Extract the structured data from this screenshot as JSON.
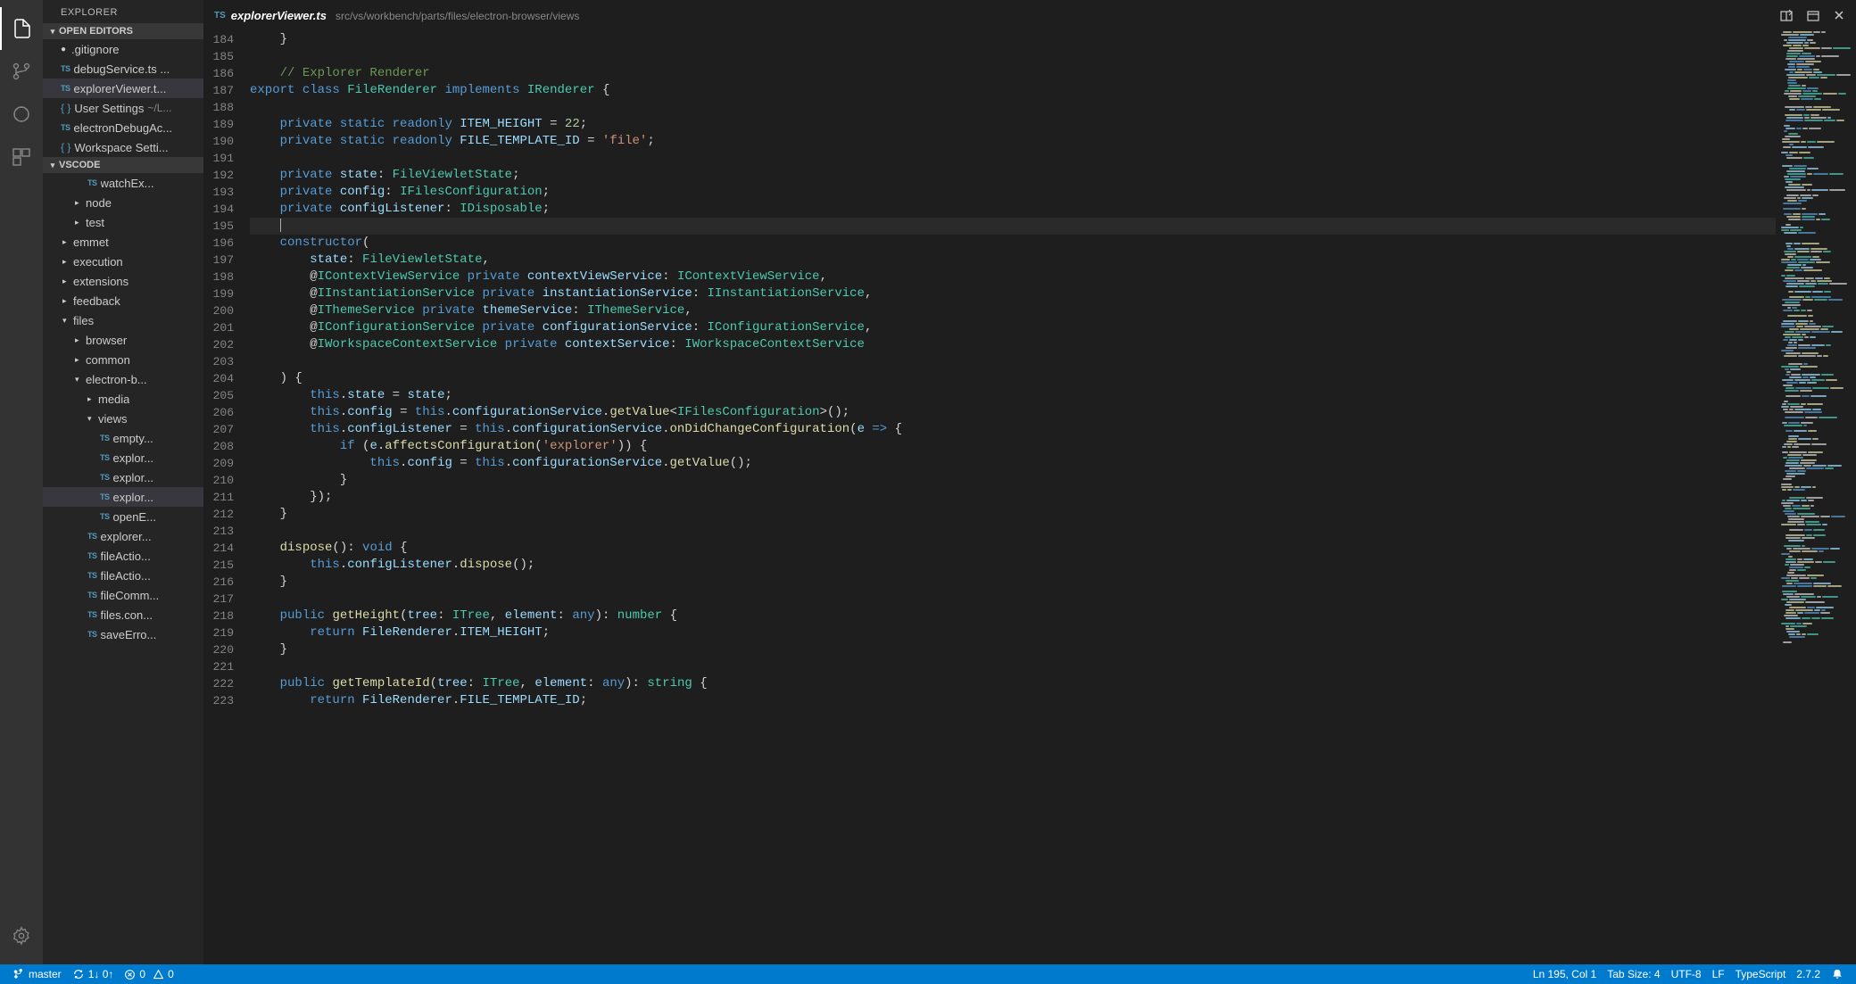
{
  "sidebar": {
    "title": "EXPLORER",
    "sections": {
      "openEditors": "OPEN EDITORS",
      "workspace": "VSCODE"
    },
    "openEditors": [
      {
        "icon": "circle",
        "label": ".gitignore"
      },
      {
        "icon": "ts",
        "label": "debugService.ts ..."
      },
      {
        "icon": "ts",
        "label": "explorerViewer.t...",
        "selected": true
      },
      {
        "icon": "brace",
        "label": "User Settings",
        "path": "~/L..."
      },
      {
        "icon": "ts",
        "label": "electronDebugAc..."
      },
      {
        "icon": "brace",
        "label": "Workspace Setti..."
      }
    ],
    "tree": [
      {
        "indent": 1,
        "icon": "ts",
        "label": "watchEx..."
      },
      {
        "indent": 0,
        "chev": "▸",
        "label": "node"
      },
      {
        "indent": 0,
        "chev": "▸",
        "label": "test"
      },
      {
        "indent": -1,
        "chev": "▸",
        "label": "emmet"
      },
      {
        "indent": -1,
        "chev": "▸",
        "label": "execution"
      },
      {
        "indent": -1,
        "chev": "▸",
        "label": "extensions"
      },
      {
        "indent": -1,
        "chev": "▸",
        "label": "feedback"
      },
      {
        "indent": -1,
        "chev": "▾",
        "label": "files"
      },
      {
        "indent": 0,
        "chev": "▸",
        "label": "browser"
      },
      {
        "indent": 0,
        "chev": "▸",
        "label": "common"
      },
      {
        "indent": 0,
        "chev": "▾",
        "label": "electron-b..."
      },
      {
        "indent": 1,
        "chev": "▸",
        "label": "media"
      },
      {
        "indent": 1,
        "chev": "▾",
        "label": "views"
      },
      {
        "indent": 2,
        "icon": "ts",
        "label": "empty..."
      },
      {
        "indent": 2,
        "icon": "ts",
        "label": "explor..."
      },
      {
        "indent": 2,
        "icon": "ts",
        "label": "explor..."
      },
      {
        "indent": 2,
        "icon": "ts",
        "label": "explor...",
        "selected": true
      },
      {
        "indent": 2,
        "icon": "ts",
        "label": "openE..."
      },
      {
        "indent": 1,
        "icon": "ts",
        "label": "explorer..."
      },
      {
        "indent": 1,
        "icon": "ts",
        "label": "fileActio..."
      },
      {
        "indent": 1,
        "icon": "ts",
        "label": "fileActio..."
      },
      {
        "indent": 1,
        "icon": "ts",
        "label": "fileComm..."
      },
      {
        "indent": 1,
        "icon": "ts",
        "label": "files.con..."
      },
      {
        "indent": 1,
        "icon": "ts",
        "label": "saveErro..."
      }
    ]
  },
  "editor": {
    "tab": {
      "icon": "TS",
      "title": "explorerViewer.ts",
      "path": "src/vs/workbench/parts/files/electron-browser/views"
    },
    "startLine": 184,
    "endLine": 223,
    "currentLine": 195
  },
  "statusBar": {
    "branch": "master",
    "sync": "1↓ 0↑",
    "errors": "0",
    "warnings": "0",
    "lineCol": "Ln 195, Col 1",
    "tabSize": "Tab Size: 4",
    "encoding": "UTF-8",
    "eol": "LF",
    "language": "TypeScript",
    "tsVersion": "2.7.2"
  },
  "code": [
    {
      "n": 184,
      "h": "    <span class='punct'>}</span>"
    },
    {
      "n": 185,
      "h": ""
    },
    {
      "n": 186,
      "h": "    <span class='comment'>// Explorer Renderer</span>"
    },
    {
      "n": 187,
      "h": "<span class='kw'>export</span> <span class='kw'>class</span> <span class='type'>FileRenderer</span> <span class='kw'>implements</span> <span class='type'>IRenderer</span> <span class='punct'>{</span>"
    },
    {
      "n": 188,
      "h": ""
    },
    {
      "n": 189,
      "h": "    <span class='kw'>private</span> <span class='kw'>static</span> <span class='kw'>readonly</span> <span class='var'>ITEM_HEIGHT</span> <span class='punct'>=</span> <span class='num'>22</span><span class='punct'>;</span>"
    },
    {
      "n": 190,
      "h": "    <span class='kw'>private</span> <span class='kw'>static</span> <span class='kw'>readonly</span> <span class='var'>FILE_TEMPLATE_ID</span> <span class='punct'>=</span> <span class='str'>'file'</span><span class='punct'>;</span>"
    },
    {
      "n": 191,
      "h": ""
    },
    {
      "n": 192,
      "h": "    <span class='kw'>private</span> <span class='var'>state</span><span class='punct'>:</span> <span class='type'>FileViewletState</span><span class='punct'>;</span>"
    },
    {
      "n": 193,
      "h": "    <span class='kw'>private</span> <span class='var'>config</span><span class='punct'>:</span> <span class='type'>IFilesConfiguration</span><span class='punct'>;</span>"
    },
    {
      "n": 194,
      "h": "    <span class='kw'>private</span> <span class='var'>configListener</span><span class='punct'>:</span> <span class='type'>IDisposable</span><span class='punct'>;</span>"
    },
    {
      "n": 195,
      "h": "    <span class='cursor'></span>",
      "current": true
    },
    {
      "n": 196,
      "h": "    <span class='kw'>constructor</span><span class='punct'>(</span>"
    },
    {
      "n": 197,
      "h": "        <span class='var'>state</span><span class='punct'>:</span> <span class='type'>FileViewletState</span><span class='punct'>,</span>"
    },
    {
      "n": 198,
      "h": "        <span class='punct'>@</span><span class='type'>IContextViewService</span> <span class='kw'>private</span> <span class='var'>contextViewService</span><span class='punct'>:</span> <span class='type'>IContextViewService</span><span class='punct'>,</span>"
    },
    {
      "n": 199,
      "h": "        <span class='punct'>@</span><span class='type'>IInstantiationService</span> <span class='kw'>private</span> <span class='var'>instantiationService</span><span class='punct'>:</span> <span class='type'>IInstantiationService</span><span class='punct'>,</span>"
    },
    {
      "n": 200,
      "h": "        <span class='punct'>@</span><span class='type'>IThemeService</span> <span class='kw'>private</span> <span class='var'>themeService</span><span class='punct'>:</span> <span class='type'>IThemeService</span><span class='punct'>,</span>"
    },
    {
      "n": 201,
      "h": "        <span class='punct'>@</span><span class='type'>IConfigurationService</span> <span class='kw'>private</span> <span class='var'>configurationService</span><span class='punct'>:</span> <span class='type'>IConfigurationService</span><span class='punct'>,</span>"
    },
    {
      "n": 202,
      "h": "        <span class='punct'>@</span><span class='type'>IWorkspaceContextService</span> <span class='kw'>private</span> <span class='var'>contextService</span><span class='punct'>:</span> <span class='type'>IWorkspaceContextService</span>"
    },
    {
      "n": 203,
      "h": ""
    },
    {
      "n": 204,
      "h": "    <span class='punct'>) {</span>"
    },
    {
      "n": 205,
      "h": "        <span class='kw'>this</span><span class='punct'>.</span><span class='var'>state</span> <span class='punct'>=</span> <span class='var'>state</span><span class='punct'>;</span>"
    },
    {
      "n": 206,
      "h": "        <span class='kw'>this</span><span class='punct'>.</span><span class='var'>config</span> <span class='punct'>=</span> <span class='kw'>this</span><span class='punct'>.</span><span class='var'>configurationService</span><span class='punct'>.</span><span class='fn'>getValue</span><span class='punct'>&lt;</span><span class='type'>IFilesConfiguration</span><span class='punct'>&gt;();</span>"
    },
    {
      "n": 207,
      "h": "        <span class='kw'>this</span><span class='punct'>.</span><span class='var'>configListener</span> <span class='punct'>=</span> <span class='kw'>this</span><span class='punct'>.</span><span class='var'>configurationService</span><span class='punct'>.</span><span class='fn'>onDidChangeConfiguration</span><span class='punct'>(</span><span class='var'>e</span> <span class='kw'>=&gt;</span> <span class='punct'>{</span>"
    },
    {
      "n": 208,
      "h": "            <span class='kw'>if</span> <span class='punct'>(</span><span class='var'>e</span><span class='punct'>.</span><span class='fn'>affectsConfiguration</span><span class='punct'>(</span><span class='str'>'explorer'</span><span class='punct'>)) {</span>"
    },
    {
      "n": 209,
      "h": "                <span class='kw'>this</span><span class='punct'>.</span><span class='var'>config</span> <span class='punct'>=</span> <span class='kw'>this</span><span class='punct'>.</span><span class='var'>configurationService</span><span class='punct'>.</span><span class='fn'>getValue</span><span class='punct'>();</span>"
    },
    {
      "n": 210,
      "h": "            <span class='punct'>}</span>"
    },
    {
      "n": 211,
      "h": "        <span class='punct'>});</span>"
    },
    {
      "n": 212,
      "h": "    <span class='punct'>}</span>"
    },
    {
      "n": 213,
      "h": ""
    },
    {
      "n": 214,
      "h": "    <span class='fn'>dispose</span><span class='punct'>():</span> <span class='kw'>void</span> <span class='punct'>{</span>"
    },
    {
      "n": 215,
      "h": "        <span class='kw'>this</span><span class='punct'>.</span><span class='var'>configListener</span><span class='punct'>.</span><span class='fn'>dispose</span><span class='punct'>();</span>"
    },
    {
      "n": 216,
      "h": "    <span class='punct'>}</span>"
    },
    {
      "n": 217,
      "h": ""
    },
    {
      "n": 218,
      "h": "    <span class='kw'>public</span> <span class='fn'>getHeight</span><span class='punct'>(</span><span class='var'>tree</span><span class='punct'>:</span> <span class='type'>ITree</span><span class='punct'>,</span> <span class='var'>element</span><span class='punct'>:</span> <span class='kw'>any</span><span class='punct'>):</span> <span class='type'>number</span> <span class='punct'>{</span>"
    },
    {
      "n": 219,
      "h": "        <span class='kw'>return</span> <span class='var'>FileRenderer</span><span class='punct'>.</span><span class='var'>ITEM_HEIGHT</span><span class='punct'>;</span>"
    },
    {
      "n": 220,
      "h": "    <span class='punct'>}</span>"
    },
    {
      "n": 221,
      "h": ""
    },
    {
      "n": 222,
      "h": "    <span class='kw'>public</span> <span class='fn'>getTemplateId</span><span class='punct'>(</span><span class='var'>tree</span><span class='punct'>:</span> <span class='type'>ITree</span><span class='punct'>,</span> <span class='var'>element</span><span class='punct'>:</span> <span class='kw'>any</span><span class='punct'>):</span> <span class='type'>string</span> <span class='punct'>{</span>"
    },
    {
      "n": 223,
      "h": "        <span class='kw'>return</span> <span class='var'>FileRenderer</span><span class='punct'>.</span><span class='var'>FILE_TEMPLATE_ID</span><span class='punct'>;</span>"
    }
  ]
}
